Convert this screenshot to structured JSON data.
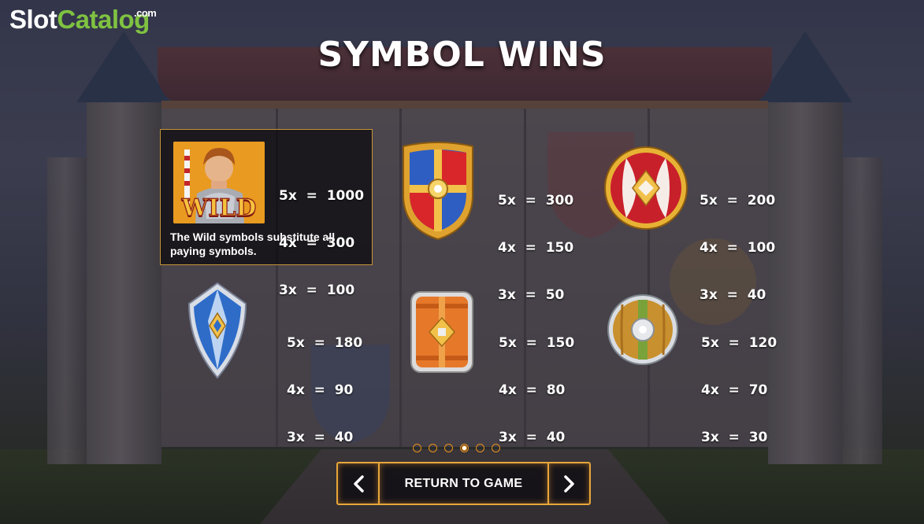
{
  "brand": {
    "slot": "Slot",
    "catalog": "Catalog",
    "com": ".com"
  },
  "title": "SYMBOL WINS",
  "wild": {
    "image_label": "WILD",
    "description": "The Wild symbols substitute all paying symbols.",
    "pays": [
      "5x  =  1000",
      "4x  =  300",
      "3x  =  100"
    ]
  },
  "symbols": [
    {
      "icon": "red-blue-cross-shield-icon",
      "pays": [
        "5x  =  300",
        "4x  =  150",
        "3x  =  50"
      ]
    },
    {
      "icon": "round-red-white-shield-icon",
      "pays": [
        "5x  =  200",
        "4x  =  100",
        "3x  =  40"
      ]
    },
    {
      "icon": "blue-kite-shield-icon",
      "pays": [
        "5x  =  180",
        "4x  =  90",
        "3x  =  40"
      ]
    },
    {
      "icon": "orange-rectangular-shield-icon",
      "pays": [
        "5x  =  150",
        "4x  =  80",
        "3x  =  40"
      ]
    },
    {
      "icon": "round-wooden-shield-icon",
      "pays": [
        "5x  =  120",
        "4x  =  70",
        "3x  =  30"
      ]
    }
  ],
  "pagination": {
    "total": 6,
    "current": 4
  },
  "nav": {
    "prev_icon": "chevron-left-icon",
    "return_label": "RETURN TO GAME",
    "next_icon": "chevron-right-icon"
  },
  "colors": {
    "accent": "#e8a63a",
    "brand_green": "#7fc241",
    "dot": "#e88f1c"
  }
}
